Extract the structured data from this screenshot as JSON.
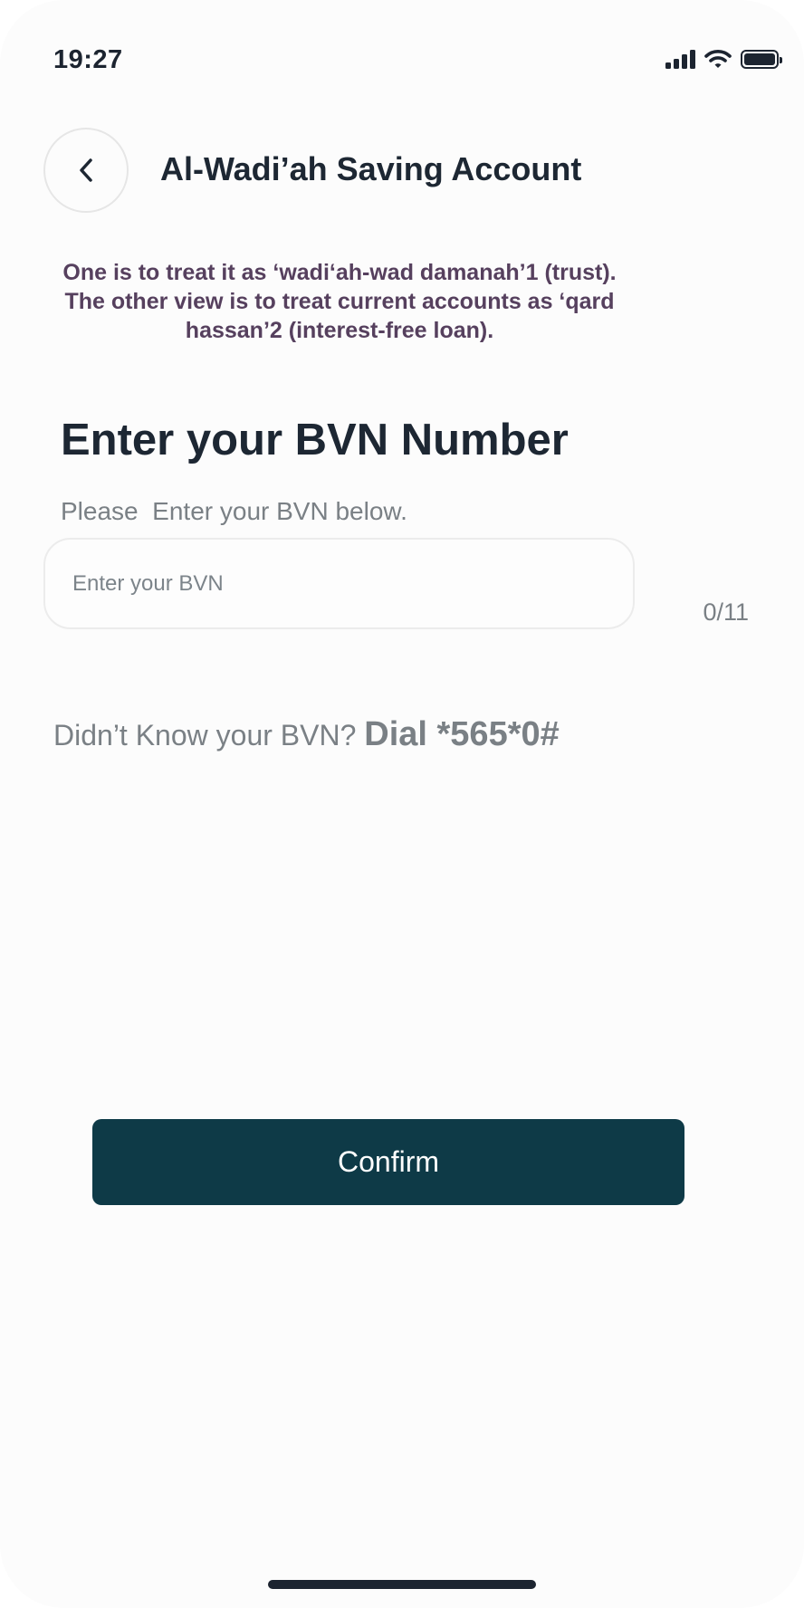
{
  "status_bar": {
    "time": "19:27",
    "icons": [
      "signal-icon",
      "wifi-icon",
      "battery-icon"
    ]
  },
  "header": {
    "back_icon": "chevron-left-icon",
    "title": "Al-Wadi’ah Saving Account"
  },
  "description": "One is to treat it as ‘wadi‘ah-wad damanah’1  (trust). The other view is to treat current accounts as ‘qard hassan’2  (interest-free loan).",
  "bvn_section": {
    "heading": "Enter your BVN Number",
    "subtext": "Please  Enter your BVN below.",
    "input_value": "",
    "input_placeholder": "Enter your BVN",
    "counter": "0/11",
    "help_text": "Didn’t Know your BVN? ",
    "dial_text": "Dial *565*0#"
  },
  "confirm_button": {
    "label": "Confirm"
  },
  "colors": {
    "background": "#fcfcfc",
    "primary": "#0e3a47",
    "title": "#1d2733",
    "description": "#56405e",
    "muted": "#7a8085"
  }
}
